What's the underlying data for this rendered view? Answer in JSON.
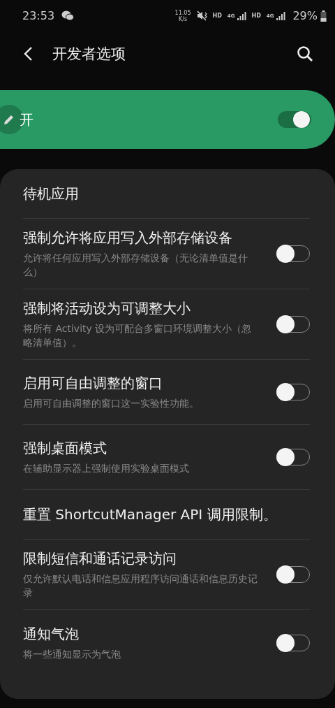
{
  "status_bar": {
    "time": "23:53",
    "speed_value": "11.05",
    "speed_unit": "K/s",
    "network_labels": [
      "HD",
      "4G",
      "HD",
      "4G"
    ],
    "battery": "29%"
  },
  "header": {
    "title": "开发者选项"
  },
  "master_switch": {
    "label": "开",
    "on": true
  },
  "settings": [
    {
      "kind": "plain",
      "title": "待机应用"
    },
    {
      "kind": "toggle",
      "title": "强制允许将应用写入外部存储设备",
      "summary": "允许将任何应用写入外部存储设备（无论清单值是什么）",
      "on": false
    },
    {
      "kind": "toggle",
      "title": "强制将活动设为可调整大小",
      "summary": "将所有 Activity 设为可配合多窗口环境调整大小（忽略清单值）。",
      "on": false
    },
    {
      "kind": "toggle",
      "title": "启用可自由调整的窗口",
      "summary": "启用可自由调整的窗口这一实验性功能。",
      "on": false
    },
    {
      "kind": "toggle",
      "title": "强制桌面模式",
      "summary": "在辅助显示器上强制使用实验桌面模式",
      "on": false
    },
    {
      "kind": "plain",
      "title": "重置 ShortcutManager API 调用限制。"
    },
    {
      "kind": "toggle",
      "title": "限制短信和通话记录访问",
      "summary": "仅允许默认电话和信息应用程序访问通话和信息历史记录",
      "on": false
    },
    {
      "kind": "toggle",
      "title": "通知气泡",
      "summary": "将一些通知显示为气泡",
      "on": false
    }
  ]
}
